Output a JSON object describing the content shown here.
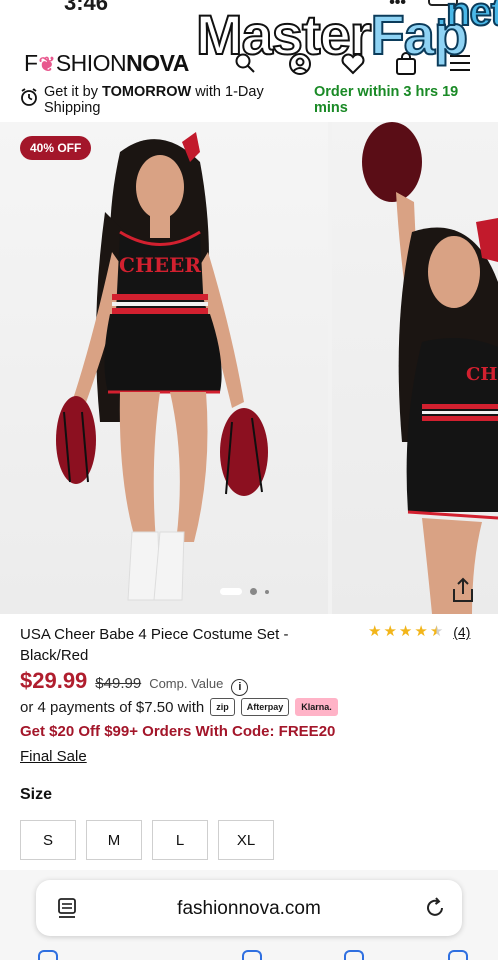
{
  "status_bar": {
    "time": "3:46",
    "signal": "•••"
  },
  "header": {
    "logo_fashion": "FASHION",
    "logo_nova": "NOVA",
    "watermark_master": "Master",
    "watermark_fap": "Fap",
    "watermark_net": ".net",
    "icons": [
      "search-icon",
      "account-icon",
      "wishlist-heart-icon",
      "bag-icon",
      "menu-icon"
    ]
  },
  "shipping": {
    "prefix": "Get it by ",
    "highlight": "TOMORROW",
    "suffix": " with 1-Day Shipping",
    "order_by": "Order within 3 hrs 19 mins"
  },
  "gallery": {
    "discount_badge": "40% OFF",
    "slide_count": 3,
    "active_slide": 1
  },
  "product": {
    "title": "USA Cheer Babe 4 Piece Costume Set - Black/Red",
    "rating": 4.5,
    "rating_count": "(4)",
    "price": "$29.99",
    "original_price": "$49.99",
    "comp_label": "Comp. Value",
    "installments": "or 4 payments of $7.50 with",
    "pay_providers": [
      "zip",
      "Afterpay",
      "Klarna."
    ],
    "promo": "Get $20 Off $99+ Orders With Code: FREE20",
    "final_sale": "Final Sale",
    "size_label": "Size",
    "sizes": [
      "S",
      "M",
      "L",
      "XL"
    ]
  },
  "browser": {
    "url": "fashionnova.com"
  },
  "colors": {
    "brand_red": "#a3162a",
    "price_red": "#b01e2e",
    "ship_green": "#1a8a26",
    "star_gold": "#f2b51a",
    "ribbon_pink": "#e8588e"
  }
}
